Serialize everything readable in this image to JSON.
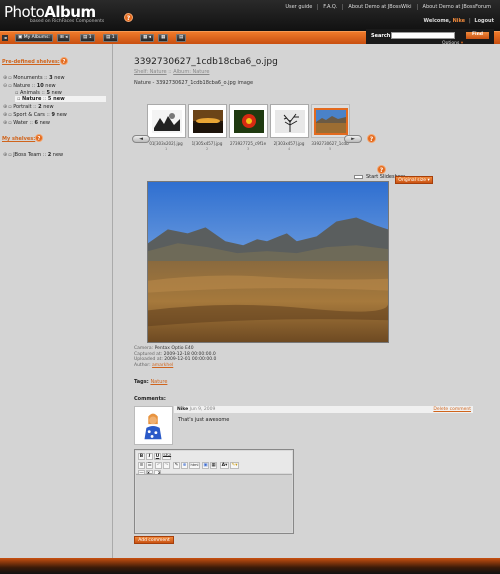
{
  "header": {
    "logo_main_light": "Photo",
    "logo_main_bold": "Album",
    "logo_sub": "based on RichFaces Components",
    "help": "?",
    "links": [
      "User guide",
      "F.A.Q.",
      "About Demo at JBossWiki",
      "About Demo at JBossForum"
    ],
    "welcome_label": "Welcome,",
    "username": "Nike",
    "logout": "Logout"
  },
  "toolbar": {
    "my_albums": "My Albums:",
    "btn2": "1",
    "btn3": "1",
    "btn4": "1"
  },
  "search": {
    "label": "Search",
    "find": "Find",
    "options": "Options",
    "options_caret": "▾"
  },
  "sidebar": {
    "predefined_title": "Pre-defined shelves:",
    "my_shelves_title": "My shelves:",
    "help": "?",
    "tree": [
      {
        "exp": "⊕",
        "pre": "",
        "name": "Monuments",
        "sep": " :: ",
        "count": "3",
        "suffix": " new",
        "bold": false
      },
      {
        "exp": "⊖",
        "pre": "",
        "name": "Nature",
        "sep": " :: ",
        "count": "10",
        "suffix": " new",
        "bold": false
      },
      {
        "exp": "",
        "pre": "",
        "name": "Animals",
        "sep": " :: ",
        "count": "5",
        "suffix": " new",
        "bold": false
      },
      {
        "exp": "",
        "pre": "",
        "name": "Nature",
        "sep": " :: ",
        "count": "5",
        "suffix": " new",
        "bold": true
      },
      {
        "exp": "⊕",
        "pre": "",
        "name": "Portrait",
        "sep": " :: ",
        "count": "2",
        "suffix": " new",
        "bold": false
      },
      {
        "exp": "⊕",
        "pre": "",
        "name": "Sport & Cars",
        "sep": " :: ",
        "count": "9",
        "suffix": " new",
        "bold": false
      },
      {
        "exp": "⊕",
        "pre": "",
        "name": "Water",
        "sep": " :: ",
        "count": "6",
        "suffix": " new",
        "bold": false
      }
    ],
    "my_tree": [
      {
        "exp": "⊕",
        "name": "JBoss Team",
        "sep": " :: ",
        "count": "2",
        "suffix": " new"
      }
    ]
  },
  "main": {
    "title": "3392730627_1cdb18cba6_o.jpg",
    "breadcrumb_shelf_label": "Shelf: Nature",
    "breadcrumb_sep": " :: ",
    "breadcrumb_album_label": "Album: Nature",
    "description": "Nature - 3392730627_1cdb18cba6_o.jpg image",
    "help": "?",
    "thumbnails": [
      {
        "caption": "01[303x202].jpg",
        "num": "1"
      },
      {
        "caption": "1[305x457].jpg",
        "num": "2"
      },
      {
        "caption": "273927725_c9f1e",
        "num": "3"
      },
      {
        "caption": "2[303x457].jpg",
        "num": "4"
      },
      {
        "caption": "3392730627_1cdb",
        "num": "5"
      }
    ],
    "slideshow": "Start Slideshow",
    "original_size": "Original size",
    "meta": {
      "camera_label": "Camera: ",
      "camera": "Pentax Optio E40",
      "captured_label": "Captured at: ",
      "captured": "2009-12-18 00:00:00.0",
      "uploaded_label": "Uploaded at: ",
      "uploaded": "2009-12-01 00:00:00.0",
      "author_label": "Author: ",
      "author": "amarkhel"
    },
    "tags_label": "Tags: ",
    "tag": "Nature",
    "comments_label": "Comments:",
    "comment": {
      "author": "Nike",
      "date": "Jun 9, 2009",
      "delete": "Delete comment",
      "text": "That's just awesome"
    },
    "editor": {
      "bold": "B",
      "italic": "I",
      "underline": "U",
      "strike": "abc",
      "font": "A",
      "sub": "x",
      "sup": "x"
    },
    "add_comment": "Add comment"
  }
}
